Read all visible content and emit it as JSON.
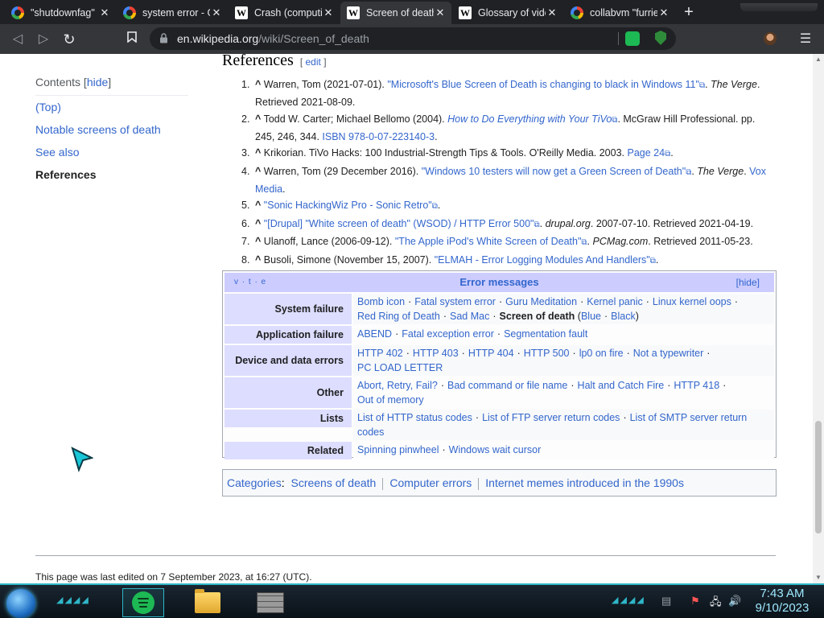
{
  "browser": {
    "tabs": [
      {
        "title": "\"shutdownfag\"",
        "favicon": "google-icon",
        "active": false
      },
      {
        "title": "system error - G",
        "favicon": "google-icon",
        "active": false
      },
      {
        "title": "Crash (computi",
        "favicon": "wikipedia-icon",
        "active": false
      },
      {
        "title": "Screen of death",
        "favicon": "wikipedia-icon",
        "active": true
      },
      {
        "title": "Glossary of vide",
        "favicon": "wikipedia-icon",
        "active": false
      },
      {
        "title": "collabvm \"furrie",
        "favicon": "google-icon",
        "active": false
      }
    ],
    "new_tab": "+",
    "url_domain": "en.wikipedia.org",
    "url_path": "/wiki/Screen_of_death"
  },
  "toc": {
    "title": "Contents",
    "hide": "hide",
    "items": [
      "(Top)",
      "Notable screens of death",
      "See also",
      "References"
    ]
  },
  "references": {
    "heading": "References",
    "edit": "edit",
    "items": [
      {
        "num": "1.",
        "pre": "Warren, Tom (2021-07-01). ",
        "link": "\"Microsoft's Blue Screen of Death is changing to black in Windows 11\"",
        "mid": ". ",
        "italic": "The Verge",
        "post": ". Retrieved 2021-08-09."
      },
      {
        "num": "2.",
        "pre": "Todd W. Carter; Michael Bellomo (2004). ",
        "link": "How to Do Everything with Your TiVo",
        "mid": ". McGraw Hill Professional. pp. 245, 246, 344. ",
        "italic": "",
        "post": "",
        "isbn": "ISBN 978-0-07-223140-3",
        "tail": "."
      },
      {
        "num": "3.",
        "pre": "Krikorian. TiVo Hacks: 100 Industrial-Strength Tips & Tools. O'Reilly Media. 2003. ",
        "link": "Page 24",
        "mid": ".",
        "italic": "",
        "post": ""
      },
      {
        "num": "4.",
        "pre": "Warren, Tom (29 December 2016). ",
        "link": "\"Windows 10 testers will now get a Green Screen of Death\"",
        "mid": ". ",
        "italic": "The Verge",
        "post": ". ",
        "link2": "Vox Media",
        "tail": "."
      },
      {
        "num": "5.",
        "pre": "",
        "link": "\"Sonic HackingWiz Pro - Sonic Retro\"",
        "mid": ".",
        "italic": "",
        "post": ""
      },
      {
        "num": "6.",
        "pre": "",
        "link": "\"[Drupal] \"White screen of death\" (WSOD) / HTTP Error 500\"",
        "mid": ". ",
        "italic": "drupal.org",
        "post": ". 2007-07-10. Retrieved 2021-04-19."
      },
      {
        "num": "7.",
        "pre": "Ulanoff, Lance (2006-09-12). ",
        "link": "\"The Apple iPod's White Screen of Death\"",
        "mid": ". ",
        "italic": "PCMag.com",
        "post": ". Retrieved 2011-05-23."
      },
      {
        "num": "8.",
        "pre": "Busoli, Simone (November 15, 2007). ",
        "link": "\"ELMAH - Error Logging Modules And Handlers\"",
        "mid": ".",
        "italic": "",
        "post": ""
      }
    ]
  },
  "navbox": {
    "vte": "v · t · e",
    "title": "Error messages",
    "hide": "hide",
    "rows": [
      {
        "group": "System failure",
        "items": [
          "Bomb icon",
          "Fatal system error",
          "Guru Meditation",
          "Kernel panic",
          "Linux kernel oops",
          "Red Ring of Death",
          "Sad Mac"
        ],
        "bold": "Screen of death",
        "paren": [
          "Blue",
          "Black"
        ]
      },
      {
        "group": "Application failure",
        "items": [
          "ABEND",
          "Fatal exception error",
          "Segmentation fault"
        ]
      },
      {
        "group": "Device and data errors",
        "items": [
          "HTTP 402",
          "HTTP 403",
          "HTTP 404",
          "HTTP 500",
          "lp0 on fire",
          "Not a typewriter",
          "PC LOAD LETTER"
        ]
      },
      {
        "group": "Other",
        "items": [
          "Abort, Retry, Fail?",
          "Bad command or file name",
          "Halt and Catch Fire",
          "HTTP 418",
          "Out of memory"
        ]
      },
      {
        "group": "Lists",
        "items": [
          "List of HTTP status codes",
          "List of FTP server return codes",
          "List of SMTP server return codes"
        ]
      },
      {
        "group": "Related",
        "items": [
          "Spinning pinwheel",
          "Windows wait cursor"
        ]
      }
    ]
  },
  "categories": {
    "label": "Categories",
    "items": [
      "Screens of death",
      "Computer errors",
      "Internet memes introduced in the 1990s"
    ]
  },
  "footer": {
    "last_edited": "This page was last edited on 7 September 2023, at 16:27 (UTC)."
  },
  "taskbar": {
    "time": "7:43 AM",
    "date": "9/10/2023"
  },
  "colors": {
    "link": "#3366cc",
    "navbox_title": "#ccccff",
    "navbox_group": "#ddddff",
    "taskbar_accent": "#2fb6c8"
  }
}
